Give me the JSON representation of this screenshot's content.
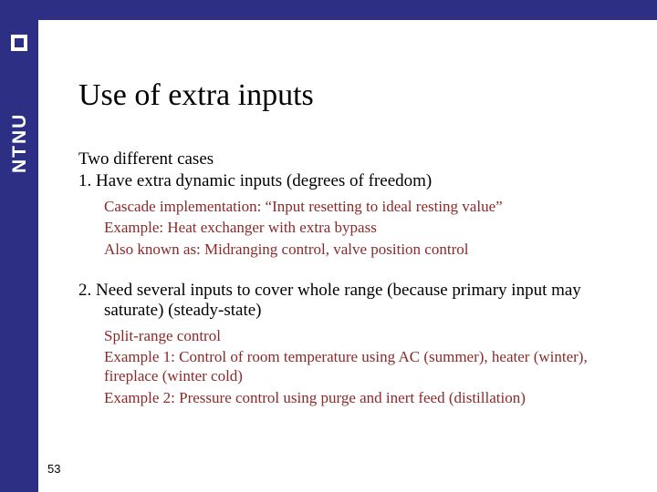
{
  "sidebar": {
    "logo_text": "NTNU"
  },
  "title": "Use of extra inputs",
  "intro": "Two different cases",
  "item1": {
    "text": "1.   Have extra dynamic inputs (degrees of freedom)",
    "sub1": "Cascade implementation: “Input resetting to ideal resting value”",
    "sub2": "Example:  Heat exchanger with extra bypass",
    "sub3": "Also known as: Midranging control, valve position control"
  },
  "item2": {
    "text": "2.   Need several inputs to cover whole range (because primary input may saturate) (steady-state)",
    "sub1": "Split-range control",
    "sub2": "Example 1: Control of room temperature using AC (summer), heater (winter), fireplace (winter cold)",
    "sub3": "Example 2: Pressure control using purge and inert feed (distillation)"
  },
  "page_number": "53"
}
